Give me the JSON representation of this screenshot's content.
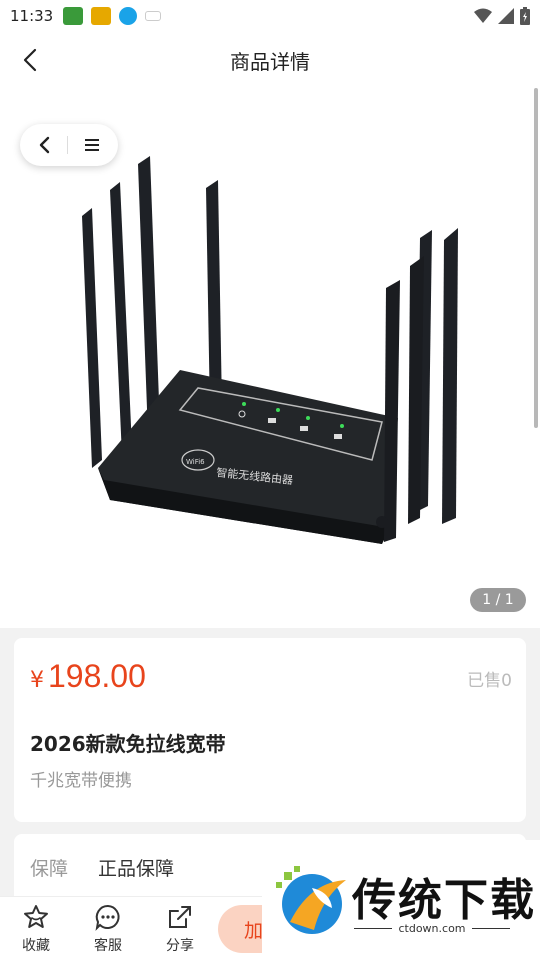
{
  "status_bar": {
    "time": "11:33",
    "notification_icons": [
      "app-icon-green",
      "app-icon-yellow",
      "download-icon",
      "small-text-icon"
    ],
    "right_icons": [
      "wifi-icon",
      "signal-icon",
      "battery-icon"
    ]
  },
  "nav": {
    "title": "商品详情",
    "back_icon": "chevron-left-icon"
  },
  "gallery": {
    "float_back_icon": "chevron-left-icon",
    "float_menu_icon": "menu-icon",
    "page_indicator": "1 / 1",
    "image_subject": "router",
    "router_label": "智能无线路由器",
    "router_logo": "WiFi6"
  },
  "price_card": {
    "currency": "¥",
    "amount": "198.00",
    "sold": "已售0",
    "title": "2026新款免拉线宽带",
    "subtitle": "千兆宽带便携"
  },
  "guarantee": {
    "label": "保障",
    "value": "正品保障"
  },
  "bottom_bar": {
    "favorite_label": "收藏",
    "service_label": "客服",
    "share_label": "分享",
    "add_cart_label": "加"
  },
  "watermark": {
    "brand": "传统下载",
    "domain": "ctdown.com"
  },
  "colors": {
    "accent": "#e8441c",
    "add_cart_bg": "#fbd3c2"
  }
}
